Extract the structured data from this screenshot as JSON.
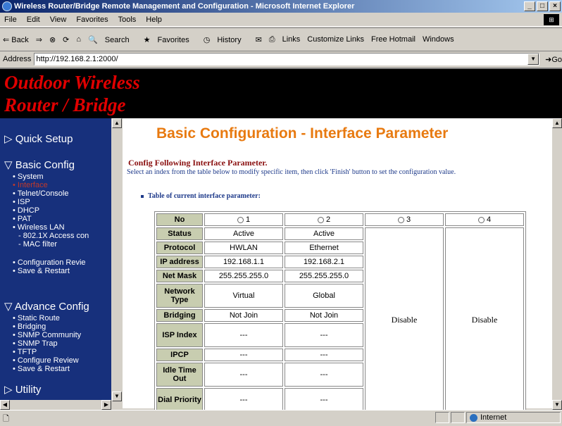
{
  "window": {
    "title": "Wireless Router/Bridge Remote Management and Configuration - Microsoft Internet Explorer"
  },
  "menu": [
    "File",
    "Edit",
    "View",
    "Favorites",
    "Tools",
    "Help"
  ],
  "toolbar": {
    "back": "⇐ Back",
    "search": "Search",
    "favorites": "Favorites",
    "history": "History",
    "links": "Links",
    "customize": "Customize Links",
    "hotmail": "Free Hotmail",
    "windows": "Windows"
  },
  "address": {
    "label": "Address",
    "url": "http://192.168.2.1:2000/",
    "go": "Go"
  },
  "banner": {
    "line1": "Outdoor Wireless",
    "line2": "Router / Bridge"
  },
  "sidebar": {
    "quick_setup": "▷ Quick Setup",
    "basic_config": "▽ Basic Config",
    "basic_items": [
      "System",
      "Interface",
      "Telnet/Console",
      "ISP",
      "DHCP",
      "PAT",
      "Wireless LAN"
    ],
    "wlan_sub": [
      "- 802.1X Access con",
      "- MAC filter"
    ],
    "basic_items2": [
      "Configuration Revie",
      "Save & Restart"
    ],
    "advance_config": "▽ Advance Config",
    "advance_items": [
      "Static Route",
      "Bridging",
      "SNMP Community",
      "SNMP Trap",
      "TFTP",
      "Configure Review",
      "Save & Restart"
    ],
    "utility": "▷ Utility"
  },
  "main": {
    "heading": "Basic Configuration - Interface Parameter",
    "subtitle": "Config Following Interface Parameter.",
    "description": "Select an index from the table below to modify specific item, then click 'Finish' button to set the configuration value.",
    "table_label": "Table of current interface parameter:"
  },
  "table": {
    "headers": [
      "No",
      "Status",
      "Protocol",
      "IP address",
      "Net Mask",
      "Network Type",
      "Bridging",
      "ISP Index",
      "IPCP",
      "Idle Time Out",
      "Dial Priority"
    ],
    "radios": [
      "1",
      "2",
      "3",
      "4"
    ],
    "col1": [
      "Active",
      "HWLAN",
      "192.168.1.1",
      "255.255.255.0",
      "Virtual",
      "Not Join",
      "---",
      "---",
      "---",
      "---"
    ],
    "col2": [
      "Active",
      "Ethernet",
      "192.168.2.1",
      "255.255.255.0",
      "Global",
      "Not Join",
      "---",
      "---",
      "---",
      "---"
    ],
    "col3": "Disable",
    "col4": "Disable"
  },
  "status": {
    "zone": "Internet"
  }
}
